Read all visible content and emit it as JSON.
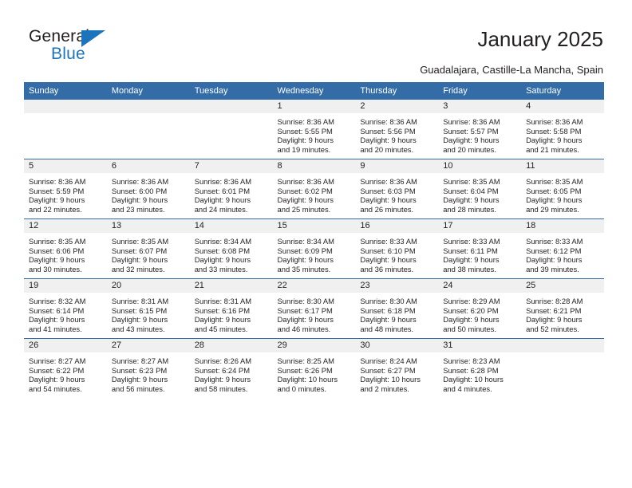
{
  "brand": {
    "name_top": "General",
    "name_bottom": "Blue",
    "accent_color": "#1c75bc"
  },
  "header": {
    "title": "January 2025",
    "subtitle": "Guadalajara, Castille-La Mancha, Spain"
  },
  "colors": {
    "header_blue": "#336ca6",
    "day_band_gray": "#f0f0f0",
    "text": "#231f20"
  },
  "weekdays": [
    "Sunday",
    "Monday",
    "Tuesday",
    "Wednesday",
    "Thursday",
    "Friday",
    "Saturday"
  ],
  "weeks": [
    [
      {
        "day": "",
        "sunrise": "",
        "sunset": "",
        "daylight1": "",
        "daylight2": ""
      },
      {
        "day": "",
        "sunrise": "",
        "sunset": "",
        "daylight1": "",
        "daylight2": ""
      },
      {
        "day": "",
        "sunrise": "",
        "sunset": "",
        "daylight1": "",
        "daylight2": ""
      },
      {
        "day": "1",
        "sunrise": "Sunrise: 8:36 AM",
        "sunset": "Sunset: 5:55 PM",
        "daylight1": "Daylight: 9 hours",
        "daylight2": "and 19 minutes."
      },
      {
        "day": "2",
        "sunrise": "Sunrise: 8:36 AM",
        "sunset": "Sunset: 5:56 PM",
        "daylight1": "Daylight: 9 hours",
        "daylight2": "and 20 minutes."
      },
      {
        "day": "3",
        "sunrise": "Sunrise: 8:36 AM",
        "sunset": "Sunset: 5:57 PM",
        "daylight1": "Daylight: 9 hours",
        "daylight2": "and 20 minutes."
      },
      {
        "day": "4",
        "sunrise": "Sunrise: 8:36 AM",
        "sunset": "Sunset: 5:58 PM",
        "daylight1": "Daylight: 9 hours",
        "daylight2": "and 21 minutes."
      }
    ],
    [
      {
        "day": "5",
        "sunrise": "Sunrise: 8:36 AM",
        "sunset": "Sunset: 5:59 PM",
        "daylight1": "Daylight: 9 hours",
        "daylight2": "and 22 minutes."
      },
      {
        "day": "6",
        "sunrise": "Sunrise: 8:36 AM",
        "sunset": "Sunset: 6:00 PM",
        "daylight1": "Daylight: 9 hours",
        "daylight2": "and 23 minutes."
      },
      {
        "day": "7",
        "sunrise": "Sunrise: 8:36 AM",
        "sunset": "Sunset: 6:01 PM",
        "daylight1": "Daylight: 9 hours",
        "daylight2": "and 24 minutes."
      },
      {
        "day": "8",
        "sunrise": "Sunrise: 8:36 AM",
        "sunset": "Sunset: 6:02 PM",
        "daylight1": "Daylight: 9 hours",
        "daylight2": "and 25 minutes."
      },
      {
        "day": "9",
        "sunrise": "Sunrise: 8:36 AM",
        "sunset": "Sunset: 6:03 PM",
        "daylight1": "Daylight: 9 hours",
        "daylight2": "and 26 minutes."
      },
      {
        "day": "10",
        "sunrise": "Sunrise: 8:35 AM",
        "sunset": "Sunset: 6:04 PM",
        "daylight1": "Daylight: 9 hours",
        "daylight2": "and 28 minutes."
      },
      {
        "day": "11",
        "sunrise": "Sunrise: 8:35 AM",
        "sunset": "Sunset: 6:05 PM",
        "daylight1": "Daylight: 9 hours",
        "daylight2": "and 29 minutes."
      }
    ],
    [
      {
        "day": "12",
        "sunrise": "Sunrise: 8:35 AM",
        "sunset": "Sunset: 6:06 PM",
        "daylight1": "Daylight: 9 hours",
        "daylight2": "and 30 minutes."
      },
      {
        "day": "13",
        "sunrise": "Sunrise: 8:35 AM",
        "sunset": "Sunset: 6:07 PM",
        "daylight1": "Daylight: 9 hours",
        "daylight2": "and 32 minutes."
      },
      {
        "day": "14",
        "sunrise": "Sunrise: 8:34 AM",
        "sunset": "Sunset: 6:08 PM",
        "daylight1": "Daylight: 9 hours",
        "daylight2": "and 33 minutes."
      },
      {
        "day": "15",
        "sunrise": "Sunrise: 8:34 AM",
        "sunset": "Sunset: 6:09 PM",
        "daylight1": "Daylight: 9 hours",
        "daylight2": "and 35 minutes."
      },
      {
        "day": "16",
        "sunrise": "Sunrise: 8:33 AM",
        "sunset": "Sunset: 6:10 PM",
        "daylight1": "Daylight: 9 hours",
        "daylight2": "and 36 minutes."
      },
      {
        "day": "17",
        "sunrise": "Sunrise: 8:33 AM",
        "sunset": "Sunset: 6:11 PM",
        "daylight1": "Daylight: 9 hours",
        "daylight2": "and 38 minutes."
      },
      {
        "day": "18",
        "sunrise": "Sunrise: 8:33 AM",
        "sunset": "Sunset: 6:12 PM",
        "daylight1": "Daylight: 9 hours",
        "daylight2": "and 39 minutes."
      }
    ],
    [
      {
        "day": "19",
        "sunrise": "Sunrise: 8:32 AM",
        "sunset": "Sunset: 6:14 PM",
        "daylight1": "Daylight: 9 hours",
        "daylight2": "and 41 minutes."
      },
      {
        "day": "20",
        "sunrise": "Sunrise: 8:31 AM",
        "sunset": "Sunset: 6:15 PM",
        "daylight1": "Daylight: 9 hours",
        "daylight2": "and 43 minutes."
      },
      {
        "day": "21",
        "sunrise": "Sunrise: 8:31 AM",
        "sunset": "Sunset: 6:16 PM",
        "daylight1": "Daylight: 9 hours",
        "daylight2": "and 45 minutes."
      },
      {
        "day": "22",
        "sunrise": "Sunrise: 8:30 AM",
        "sunset": "Sunset: 6:17 PM",
        "daylight1": "Daylight: 9 hours",
        "daylight2": "and 46 minutes."
      },
      {
        "day": "23",
        "sunrise": "Sunrise: 8:30 AM",
        "sunset": "Sunset: 6:18 PM",
        "daylight1": "Daylight: 9 hours",
        "daylight2": "and 48 minutes."
      },
      {
        "day": "24",
        "sunrise": "Sunrise: 8:29 AM",
        "sunset": "Sunset: 6:20 PM",
        "daylight1": "Daylight: 9 hours",
        "daylight2": "and 50 minutes."
      },
      {
        "day": "25",
        "sunrise": "Sunrise: 8:28 AM",
        "sunset": "Sunset: 6:21 PM",
        "daylight1": "Daylight: 9 hours",
        "daylight2": "and 52 minutes."
      }
    ],
    [
      {
        "day": "26",
        "sunrise": "Sunrise: 8:27 AM",
        "sunset": "Sunset: 6:22 PM",
        "daylight1": "Daylight: 9 hours",
        "daylight2": "and 54 minutes."
      },
      {
        "day": "27",
        "sunrise": "Sunrise: 8:27 AM",
        "sunset": "Sunset: 6:23 PM",
        "daylight1": "Daylight: 9 hours",
        "daylight2": "and 56 minutes."
      },
      {
        "day": "28",
        "sunrise": "Sunrise: 8:26 AM",
        "sunset": "Sunset: 6:24 PM",
        "daylight1": "Daylight: 9 hours",
        "daylight2": "and 58 minutes."
      },
      {
        "day": "29",
        "sunrise": "Sunrise: 8:25 AM",
        "sunset": "Sunset: 6:26 PM",
        "daylight1": "Daylight: 10 hours",
        "daylight2": "and 0 minutes."
      },
      {
        "day": "30",
        "sunrise": "Sunrise: 8:24 AM",
        "sunset": "Sunset: 6:27 PM",
        "daylight1": "Daylight: 10 hours",
        "daylight2": "and 2 minutes."
      },
      {
        "day": "31",
        "sunrise": "Sunrise: 8:23 AM",
        "sunset": "Sunset: 6:28 PM",
        "daylight1": "Daylight: 10 hours",
        "daylight2": "and 4 minutes."
      },
      {
        "day": "",
        "sunrise": "",
        "sunset": "",
        "daylight1": "",
        "daylight2": ""
      }
    ]
  ]
}
